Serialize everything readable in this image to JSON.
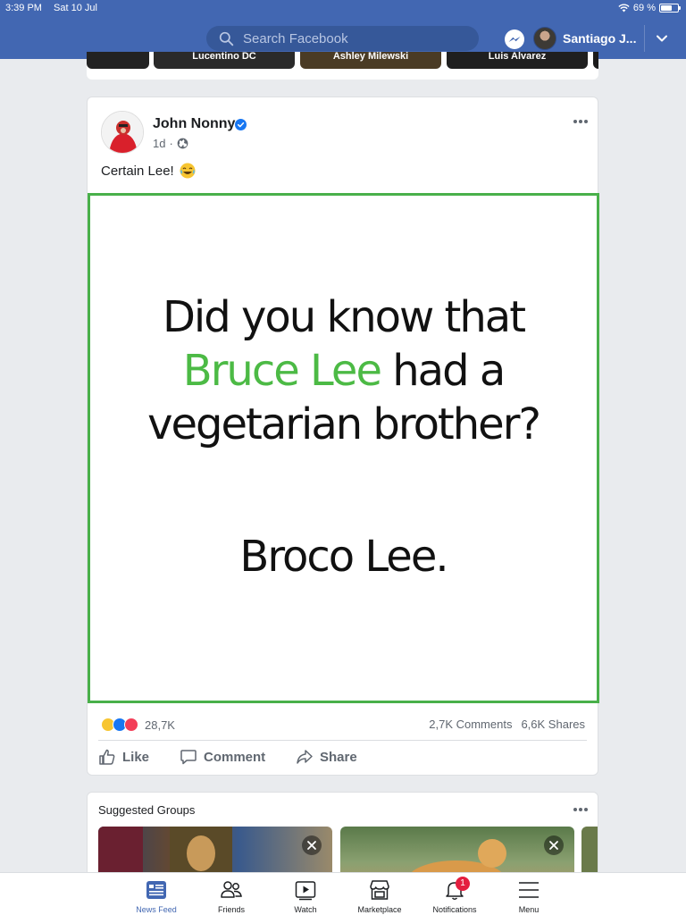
{
  "status_bar": {
    "time": "3:39 PM",
    "date": "Sat 10 Jul",
    "battery": "69 %",
    "battery_level": 0.69
  },
  "header": {
    "search_placeholder": "Search Facebook",
    "user_name": "Santiago J...",
    "brand_color": "#4267b2"
  },
  "stories": [
    {
      "label": "Lucentino DC",
      "color": "#2a2a2a"
    },
    {
      "label": "Ashley Milewski",
      "color": "#4a3b25"
    },
    {
      "label": "Luis Alvarez",
      "color": "#1f1f1f"
    }
  ],
  "post": {
    "author": "John Nonny",
    "time": "1d",
    "text": "Certain Lee!",
    "meme": {
      "line1": "Did you know that",
      "line2_highlight": "Bruce Lee",
      "line2_rest": " had a",
      "line3": "vegetarian brother?",
      "punchline": "Broco Lee.",
      "highlight_color": "#4cba45"
    },
    "reaction_count": "28,7K",
    "comments": "2,7K Comments",
    "shares": "6,6K Shares",
    "actions": {
      "like": "Like",
      "comment": "Comment",
      "share": "Share"
    }
  },
  "suggested_groups": {
    "title": "Suggested Groups"
  },
  "tabs": [
    {
      "label": "News Feed",
      "icon": "news-feed-icon",
      "active": true
    },
    {
      "label": "Friends",
      "icon": "friends-icon"
    },
    {
      "label": "Watch",
      "icon": "watch-icon"
    },
    {
      "label": "Marketplace",
      "icon": "marketplace-icon"
    },
    {
      "label": "Notifications",
      "icon": "bell-icon",
      "badge": "1"
    },
    {
      "label": "Menu",
      "icon": "menu-icon"
    }
  ]
}
